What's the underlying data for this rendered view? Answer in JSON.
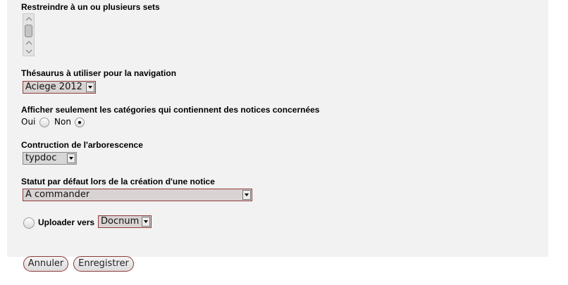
{
  "sets": {
    "label": "Restreindre à un ou plusieurs sets"
  },
  "thesaurus": {
    "label": "Thésaurus à utiliser pour la navigation",
    "selected": "Aciege 2012"
  },
  "categories": {
    "label": "Afficher seulement les catégories qui contiennent des notices concernées",
    "options": [
      {
        "label": "Oui",
        "checked": false
      },
      {
        "label": "Non",
        "checked": true
      }
    ]
  },
  "tree": {
    "label": "Contruction de l'arborescence",
    "selected": "typdoc"
  },
  "status": {
    "label": "Statut par défaut lors de la création d'une notice",
    "selected": "A commander"
  },
  "upload": {
    "label": "Uploader vers",
    "selected": "Docnum"
  },
  "actions": {
    "cancel": "Annuler",
    "save": "Enregistrer"
  }
}
